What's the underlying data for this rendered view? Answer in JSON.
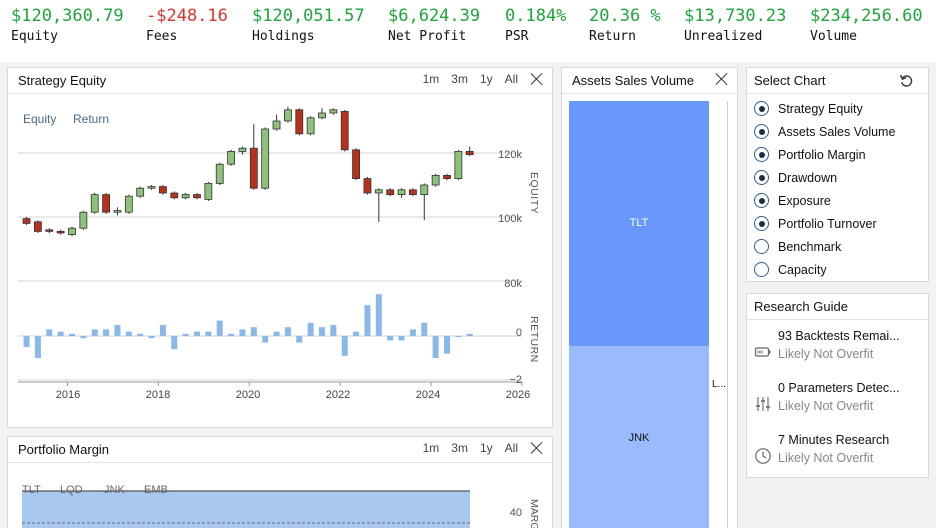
{
  "stats": [
    {
      "value": "$120,360.79",
      "label": "Equity",
      "negative": false
    },
    {
      "value": "-$248.16",
      "label": "Fees",
      "negative": true
    },
    {
      "value": "$120,051.57",
      "label": "Holdings",
      "negative": false
    },
    {
      "value": "$6,624.39",
      "label": "Net Profit",
      "negative": false
    },
    {
      "value": "0.184%",
      "label": "PSR",
      "negative": false
    },
    {
      "value": "20.36 %",
      "label": "Return",
      "negative": false
    },
    {
      "value": "$13,730.23",
      "label": "Unrealized",
      "negative": false
    },
    {
      "value": "$234,256.60",
      "label": "Volume",
      "negative": false
    }
  ],
  "strategy_equity": {
    "title": "Strategy Equity",
    "ranges": [
      "1m",
      "3m",
      "1y",
      "All"
    ],
    "legend": [
      "Equity",
      "Return"
    ],
    "equity_axis_label": "EQUITY",
    "return_axis_label": "RETURN",
    "equity_ticks": [
      "120k",
      "100k",
      "80k"
    ],
    "return_ticks": [
      "0",
      "−2"
    ],
    "x_ticks": [
      "2016",
      "2018",
      "2020",
      "2022",
      "2024",
      "2026"
    ]
  },
  "assets_sales_volume": {
    "title": "Assets Sales Volume",
    "segments": [
      "TLT",
      "JNK"
    ],
    "side_label": "L..."
  },
  "portfolio_margin": {
    "title": "Portfolio Margin",
    "ranges": [
      "1m",
      "3m",
      "1y",
      "All"
    ],
    "series": [
      "TLT",
      "LQD",
      "JNK",
      "EMB"
    ],
    "tick": "40",
    "axis_label": "MARG"
  },
  "select_chart": {
    "title": "Select Chart",
    "items": [
      {
        "label": "Strategy Equity",
        "checked": true
      },
      {
        "label": "Assets Sales Volume",
        "checked": true
      },
      {
        "label": "Portfolio Margin",
        "checked": true
      },
      {
        "label": "Drawdown",
        "checked": true
      },
      {
        "label": "Exposure",
        "checked": true
      },
      {
        "label": "Portfolio Turnover",
        "checked": true
      },
      {
        "label": "Benchmark",
        "checked": false
      },
      {
        "label": "Capacity",
        "checked": false
      }
    ]
  },
  "research_guide": {
    "title": "Research Guide",
    "items": [
      {
        "title": "93 Backtests Remai...",
        "sub": "Likely Not Overfit",
        "icon": "battery-icon"
      },
      {
        "title": "0 Parameters Detec...",
        "sub": "Likely Not Overfit",
        "icon": "sliders-icon"
      },
      {
        "title": "7 Minutes Research",
        "sub": "Likely Not Overfit",
        "icon": "clock-icon"
      }
    ]
  },
  "chart_data": [
    {
      "type": "candlestick",
      "title": "Strategy Equity",
      "ylabel": "EQUITY",
      "ylim": [
        75000,
        135000
      ],
      "xlim": [
        2015,
        2026
      ],
      "grid": true,
      "candles": [
        {
          "x": 2015.1,
          "o": 99500,
          "c": 98000,
          "h": 100000,
          "l": 97500
        },
        {
          "x": 2015.35,
          "o": 98500,
          "c": 95500,
          "h": 99000,
          "l": 95000
        },
        {
          "x": 2015.6,
          "o": 96000,
          "c": 95500,
          "h": 96500,
          "l": 95000
        },
        {
          "x": 2015.85,
          "o": 95500,
          "c": 95000,
          "h": 96000,
          "l": 94500
        },
        {
          "x": 2016.1,
          "o": 94500,
          "c": 96500,
          "h": 97000,
          "l": 94000
        },
        {
          "x": 2016.35,
          "o": 96500,
          "c": 101500,
          "h": 102000,
          "l": 96000
        },
        {
          "x": 2016.6,
          "o": 101500,
          "c": 107000,
          "h": 107500,
          "l": 101000
        },
        {
          "x": 2016.85,
          "o": 107000,
          "c": 101500,
          "h": 107500,
          "l": 101000
        },
        {
          "x": 2017.1,
          "o": 101500,
          "c": 102000,
          "h": 103000,
          "l": 100500
        },
        {
          "x": 2017.35,
          "o": 101500,
          "c": 106500,
          "h": 107000,
          "l": 101000
        },
        {
          "x": 2017.6,
          "o": 106500,
          "c": 109000,
          "h": 109500,
          "l": 106000
        },
        {
          "x": 2017.85,
          "o": 109000,
          "c": 109500,
          "h": 110000,
          "l": 108500
        },
        {
          "x": 2018.1,
          "o": 109500,
          "c": 107500,
          "h": 110000,
          "l": 107000
        },
        {
          "x": 2018.35,
          "o": 107500,
          "c": 106000,
          "h": 108000,
          "l": 105500
        },
        {
          "x": 2018.6,
          "o": 106000,
          "c": 107000,
          "h": 107500,
          "l": 105500
        },
        {
          "x": 2018.85,
          "o": 107000,
          "c": 106000,
          "h": 107500,
          "l": 105500
        },
        {
          "x": 2019.1,
          "o": 105500,
          "c": 110500,
          "h": 111000,
          "l": 105000
        },
        {
          "x": 2019.35,
          "o": 110500,
          "c": 116500,
          "h": 117000,
          "l": 110000
        },
        {
          "x": 2019.6,
          "o": 116500,
          "c": 120500,
          "h": 121000,
          "l": 116000
        },
        {
          "x": 2019.85,
          "o": 120500,
          "c": 121500,
          "h": 122000,
          "l": 119500
        },
        {
          "x": 2020.1,
          "o": 121500,
          "c": 109000,
          "h": 129000,
          "l": 108500
        },
        {
          "x": 2020.35,
          "o": 109000,
          "c": 127500,
          "h": 128000,
          "l": 108500
        },
        {
          "x": 2020.6,
          "o": 127500,
          "c": 130000,
          "h": 132000,
          "l": 127000
        },
        {
          "x": 2020.85,
          "o": 130000,
          "c": 133500,
          "h": 134500,
          "l": 129500
        },
        {
          "x": 2021.1,
          "o": 133500,
          "c": 126000,
          "h": 134000,
          "l": 125500
        },
        {
          "x": 2021.35,
          "o": 126000,
          "c": 131000,
          "h": 131500,
          "l": 125500
        },
        {
          "x": 2021.6,
          "o": 131000,
          "c": 132500,
          "h": 134000,
          "l": 130500
        },
        {
          "x": 2021.85,
          "o": 132500,
          "c": 133500,
          "h": 134000,
          "l": 132000
        },
        {
          "x": 2022.1,
          "o": 133000,
          "c": 121000,
          "h": 133500,
          "l": 120500
        },
        {
          "x": 2022.35,
          "o": 121000,
          "c": 112000,
          "h": 121500,
          "l": 111500
        },
        {
          "x": 2022.6,
          "o": 112000,
          "c": 107500,
          "h": 112500,
          "l": 107000
        },
        {
          "x": 2022.85,
          "o": 107500,
          "c": 108500,
          "h": 109000,
          "l": 98500
        },
        {
          "x": 2023.1,
          "o": 108500,
          "c": 107000,
          "h": 109000,
          "l": 106500
        },
        {
          "x": 2023.35,
          "o": 107000,
          "c": 108500,
          "h": 109000,
          "l": 106000
        },
        {
          "x": 2023.6,
          "o": 108500,
          "c": 107000,
          "h": 109000,
          "l": 106500
        },
        {
          "x": 2023.85,
          "o": 107000,
          "c": 110000,
          "h": 110500,
          "l": 99000
        },
        {
          "x": 2024.1,
          "o": 110000,
          "c": 113000,
          "h": 113500,
          "l": 109500
        },
        {
          "x": 2024.35,
          "o": 113000,
          "c": 112000,
          "h": 113500,
          "l": 111500
        },
        {
          "x": 2024.6,
          "o": 112000,
          "c": 120500,
          "h": 121000,
          "l": 111500
        },
        {
          "x": 2024.85,
          "o": 120500,
          "c": 119500,
          "h": 122000,
          "l": 119000
        }
      ]
    },
    {
      "type": "bar",
      "title": "Return",
      "ylabel": "RETURN",
      "ylim": [
        -2.3,
        2.2
      ],
      "x": [
        2015.1,
        2015.35,
        2015.6,
        2015.85,
        2016.1,
        2016.35,
        2016.6,
        2016.85,
        2017.1,
        2017.35,
        2017.6,
        2017.85,
        2018.1,
        2018.35,
        2018.6,
        2018.85,
        2019.1,
        2019.35,
        2019.6,
        2019.85,
        2020.1,
        2020.35,
        2020.6,
        2020.85,
        2021.1,
        2021.35,
        2021.6,
        2021.85,
        2022.1,
        2022.35,
        2022.6,
        2022.85,
        2023.1,
        2023.35,
        2023.6,
        2023.85,
        2024.1,
        2024.35,
        2024.6,
        2024.85
      ],
      "values": [
        -0.5,
        -1.0,
        0.3,
        0.2,
        0.1,
        -0.1,
        0.3,
        0.3,
        0.5,
        0.2,
        0.1,
        -0.1,
        0.5,
        -0.6,
        0.1,
        0.2,
        0.2,
        0.7,
        0.1,
        0.3,
        0.4,
        -0.3,
        0.2,
        0.4,
        -0.3,
        0.6,
        0.4,
        0.5,
        -0.9,
        0.2,
        1.4,
        1.9,
        -0.2,
        -0.2,
        0.3,
        0.6,
        -1.0,
        -0.8,
        0.0,
        0.1
      ]
    },
    {
      "type": "bar",
      "title": "Assets Sales Volume",
      "categories": [
        "TLT",
        "JNK"
      ],
      "values": [
        0.5,
        0.5
      ]
    },
    {
      "type": "area",
      "title": "Portfolio Margin",
      "series": [
        {
          "name": "TLT"
        },
        {
          "name": "LQD"
        },
        {
          "name": "JNK"
        },
        {
          "name": "EMB"
        }
      ],
      "ticks": [
        40
      ]
    }
  ]
}
